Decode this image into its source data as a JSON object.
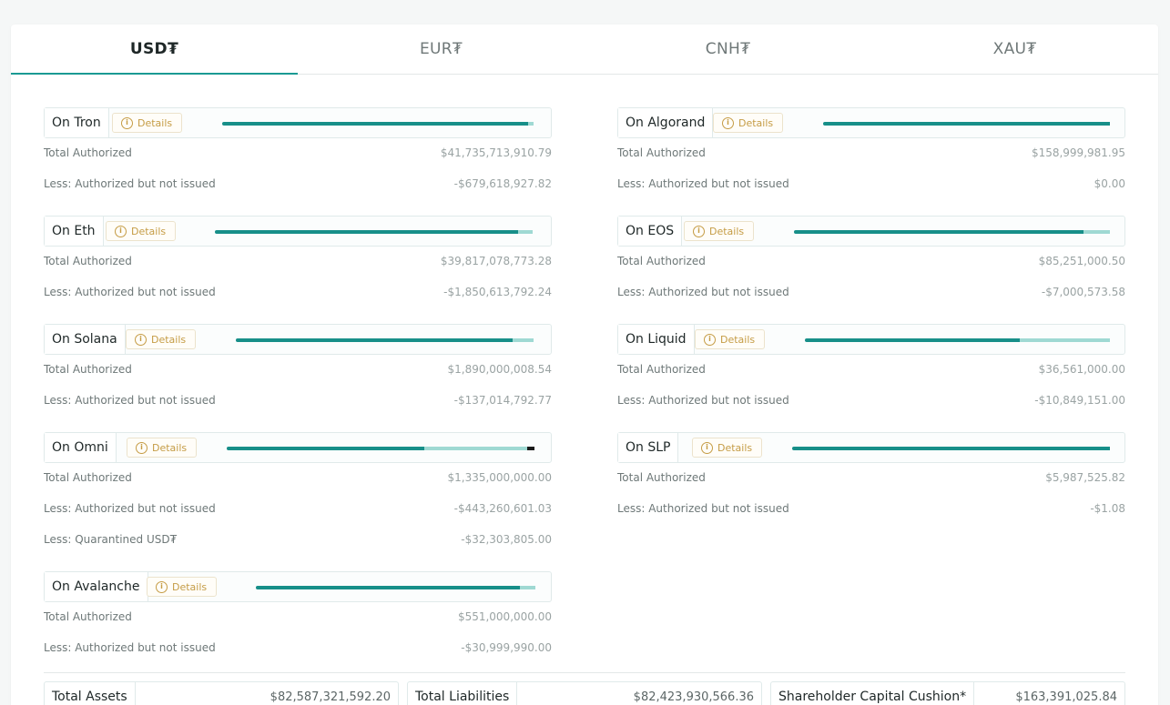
{
  "tabs": [
    {
      "label": "USD₮",
      "active": true
    },
    {
      "label": "EUR₮",
      "active": false
    },
    {
      "label": "CNH₮",
      "active": false
    },
    {
      "label": "XAU₮",
      "active": false
    }
  ],
  "details_label": "Details",
  "left": [
    {
      "name": "On Tron",
      "bar": {
        "issued_pct": 0.975,
        "unissued_pct": 0.016,
        "quarantined_pct": 0
      },
      "rows": [
        {
          "label": "Total Authorized",
          "value": "$41,735,713,910.79"
        },
        {
          "label": "Less: Authorized but not issued",
          "value": "-$679,618,927.82"
        }
      ]
    },
    {
      "name": "On Eth",
      "bar": {
        "issued_pct": 0.944,
        "unissued_pct": 0.046,
        "quarantined_pct": 0
      },
      "rows": [
        {
          "label": "Total Authorized",
          "value": "$39,817,078,773.28"
        },
        {
          "label": "Less: Authorized but not issued",
          "value": "-$1,850,613,792.24"
        }
      ]
    },
    {
      "name": "On Solana",
      "bar": {
        "issued_pct": 0.92,
        "unissued_pct": 0.072,
        "quarantined_pct": 0
      },
      "rows": [
        {
          "label": "Total Authorized",
          "value": "$1,890,000,008.54"
        },
        {
          "label": "Less: Authorized but not issued",
          "value": "-$137,014,792.77"
        }
      ]
    },
    {
      "name": "On Omni",
      "bar": {
        "issued_pct": 0.638,
        "unissued_pct": 0.332,
        "quarantined_pct": 0.024
      },
      "rows": [
        {
          "label": "Total Authorized",
          "value": "$1,335,000,000.00"
        },
        {
          "label": "Less: Authorized but not issued",
          "value": "-$443,260,601.03"
        },
        {
          "label": "Less: Quarantined USD₮",
          "value": "-$32,303,805.00"
        }
      ]
    },
    {
      "name": "On Avalanche",
      "bar": {
        "issued_pct": 0.94,
        "unissued_pct": 0.056,
        "quarantined_pct": 0
      },
      "rows": [
        {
          "label": "Total Authorized",
          "value": "$551,000,000.00"
        },
        {
          "label": "Less: Authorized but not issued",
          "value": "-$30,999,990.00"
        }
      ]
    }
  ],
  "right": [
    {
      "name": "On Algorand",
      "bar": {
        "issued_pct": 1.0,
        "unissued_pct": 0,
        "quarantined_pct": 0
      },
      "rows": [
        {
          "label": "Total Authorized",
          "value": "$158,999,981.95"
        },
        {
          "label": "Less: Authorized but not issued",
          "value": "$0.00"
        }
      ]
    },
    {
      "name": "On EOS",
      "bar": {
        "issued_pct": 0.916,
        "unissued_pct": 0.084,
        "quarantined_pct": 0
      },
      "rows": [
        {
          "label": "Total Authorized",
          "value": "$85,251,000.50"
        },
        {
          "label": "Less: Authorized but not issued",
          "value": "-$7,000,573.58"
        }
      ]
    },
    {
      "name": "On Liquid",
      "bar": {
        "issued_pct": 0.703,
        "unissued_pct": 0.297,
        "quarantined_pct": 0
      },
      "rows": [
        {
          "label": "Total Authorized",
          "value": "$36,561,000.00"
        },
        {
          "label": "Less: Authorized but not issued",
          "value": "-$10,849,151.00"
        }
      ]
    },
    {
      "name": "On SLP",
      "bar": {
        "issued_pct": 1.0,
        "unissued_pct": 0,
        "quarantined_pct": 0
      },
      "rows": [
        {
          "label": "Total Authorized",
          "value": "$5,987,525.82"
        },
        {
          "label": "Less: Authorized but not issued",
          "value": "-$1.08"
        }
      ]
    }
  ],
  "summary": [
    {
      "label": "Total Assets",
      "value": "$82,587,321,592.20"
    },
    {
      "label": "Total Liabilities",
      "value": "$82,423,930,566.36"
    },
    {
      "label": "Shareholder Capital Cushion*",
      "value": "$163,391,025.84"
    }
  ],
  "colors": {
    "issued": "#178f89",
    "unissued": "#9fd9d3",
    "quarantined": "#1a1a1a",
    "details": "#c59c45",
    "accent": "#1a9a93"
  },
  "icons": {
    "details": "info-circle-icon"
  }
}
